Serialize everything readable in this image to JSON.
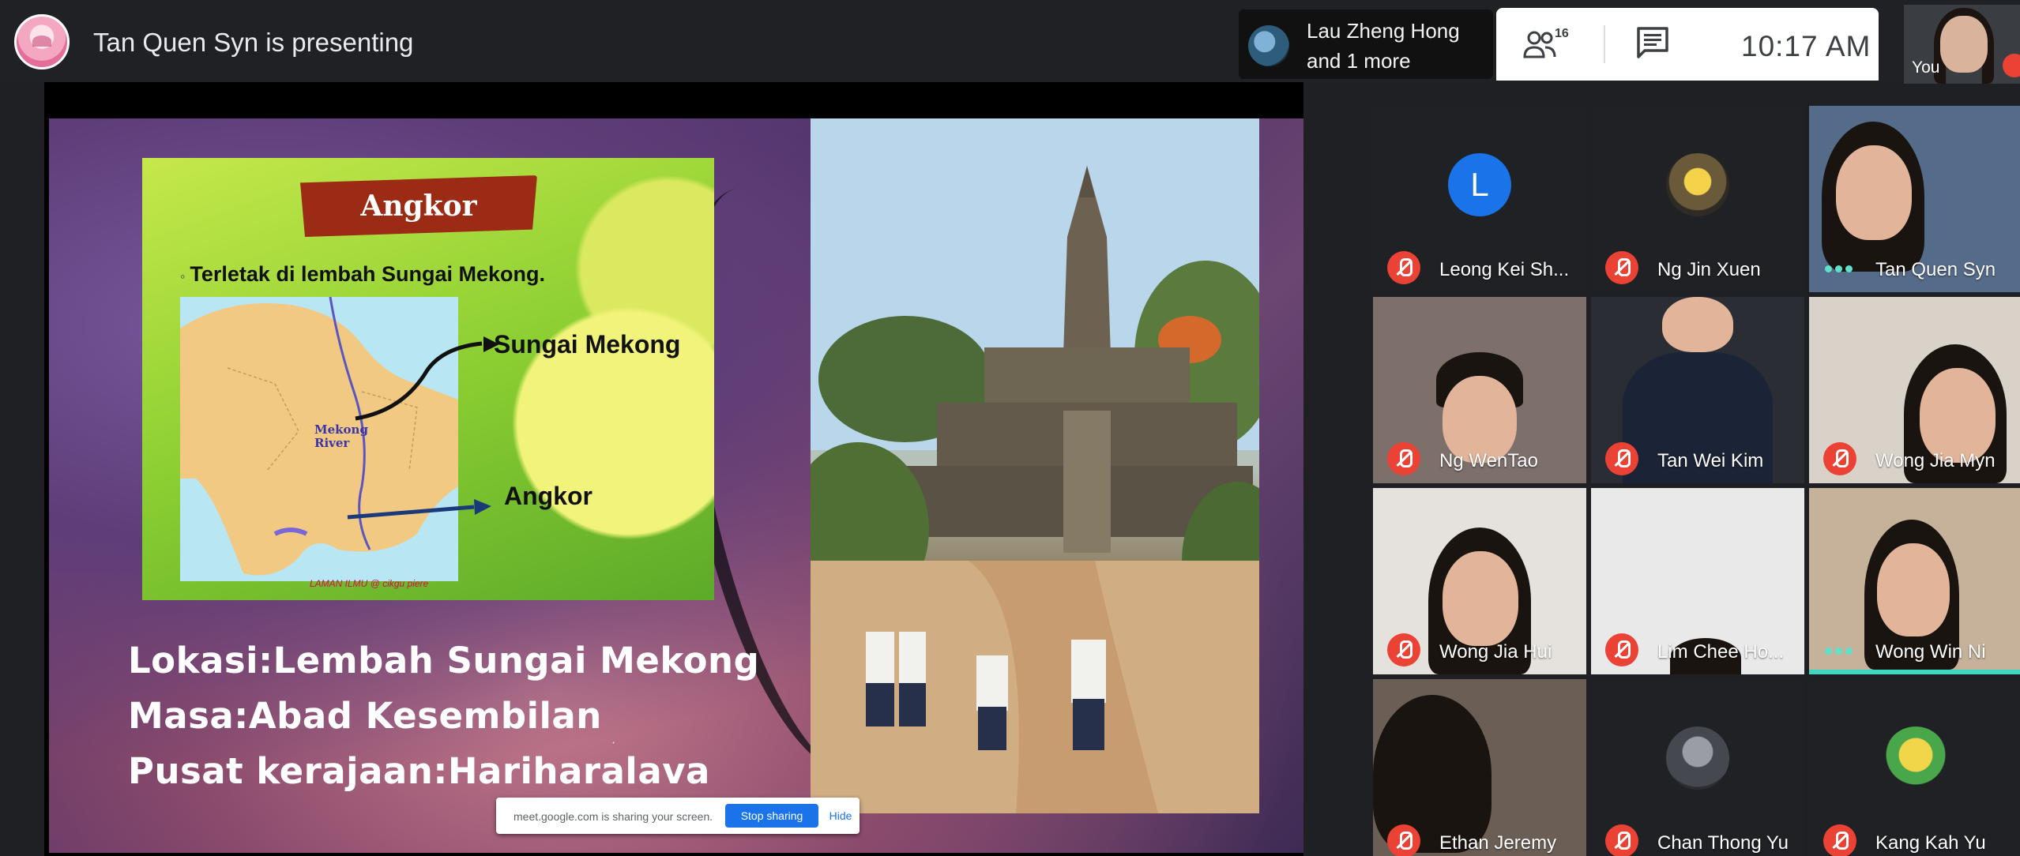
{
  "topbar": {
    "presenting_text": "Tan Quen Syn is presenting",
    "chip_name": "Lau Zheng Hong",
    "chip_more": "and 1 more",
    "people_count": "16",
    "clock": "10:17 AM",
    "self_label": "You"
  },
  "slide": {
    "banner": "Angkor",
    "subtitle": "Terletak di lembah Sungai Mekong.",
    "label_mekong": "Sungai Mekong",
    "label_angkor": "Angkor",
    "river_label_1": "Mekong",
    "river_label_2": "River",
    "map_caption": "LAMAN ILMU @ cikgu piere",
    "line1": "Lokasi:Lembah Sungai Mekong",
    "line2": "Masa:Abad Kesembilan",
    "line3": "Pusat kerajaan:Hariharalava"
  },
  "share_bar": {
    "text": "meet.google.com is sharing your screen.",
    "stop": "Stop sharing",
    "hide": "Hide"
  },
  "participants": [
    {
      "name": "Leong Kei Sh...",
      "avatar": "L"
    },
    {
      "name": "Ng Jin Xuen"
    },
    {
      "name": "Tan Quen Syn"
    },
    {
      "name": "Ng WenTao"
    },
    {
      "name": "Tan Wei Kim"
    },
    {
      "name": "Wong Jia Myn"
    },
    {
      "name": "Wong Jia Hui"
    },
    {
      "name": "Lim Chee Ho..."
    },
    {
      "name": "Wong Win Ni"
    },
    {
      "name": "Ethan Jeremy"
    },
    {
      "name": "Chan Thong Yu"
    },
    {
      "name": "Kang Kah Yu"
    }
  ],
  "colors": {
    "mic_off": "#ea4335",
    "speaking": "#3fd7c0",
    "avatar_blue": "#1a73e8",
    "angkor_banner": "#9b2b14"
  }
}
